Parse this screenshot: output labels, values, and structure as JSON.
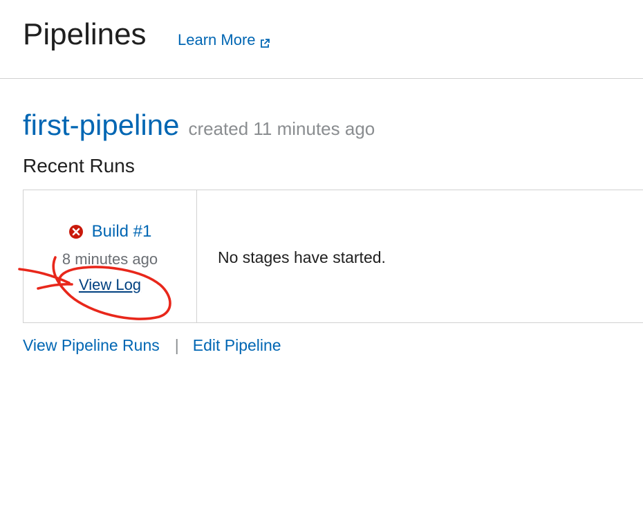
{
  "header": {
    "title": "Pipelines",
    "learn_more": "Learn More",
    "external_link_icon": "external-link-icon"
  },
  "pipeline": {
    "name": "first-pipeline",
    "created": "created 11 minutes ago"
  },
  "recent_runs": {
    "title": "Recent Runs",
    "runs": [
      {
        "status_icon": "error-circle-icon",
        "status_color": "#c9190b",
        "name": "Build #1",
        "time": "8 minutes ago",
        "view_log": "View Log"
      }
    ],
    "stages_message": "No stages have started."
  },
  "footer": {
    "view_runs": "View Pipeline Runs",
    "separator": "|",
    "edit": "Edit Pipeline"
  },
  "annotation": {
    "color": "#e8271b",
    "shape": "hand-drawn circle with arrow"
  }
}
